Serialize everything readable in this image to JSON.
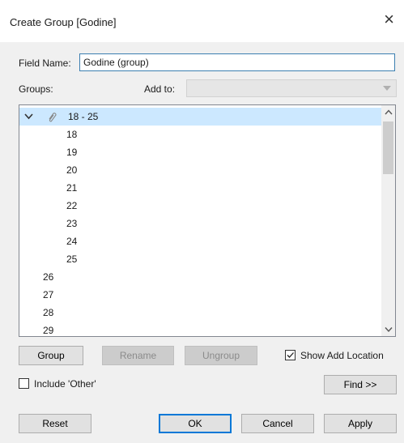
{
  "dialog": {
    "title": "Create Group [Godine]",
    "close_glyph": "×"
  },
  "field_name": {
    "label": "Field Name:",
    "value": "Godine (group)"
  },
  "groups_label": "Groups:",
  "add_to": {
    "label": "Add to:",
    "value": ""
  },
  "tree": {
    "group": {
      "label": "18 - 25",
      "expanded": true,
      "members": [
        "18",
        "19",
        "20",
        "21",
        "22",
        "23",
        "24",
        "25"
      ]
    },
    "ungrouped": [
      "26",
      "27",
      "28",
      "29"
    ]
  },
  "buttons": {
    "group": "Group",
    "rename": "Rename",
    "ungroup": "Ungroup",
    "find": "Find >>",
    "reset": "Reset",
    "ok": "OK",
    "cancel": "Cancel",
    "apply": "Apply"
  },
  "show_add_location": {
    "label": "Show Add Location",
    "checked": true
  },
  "include_other": {
    "label": "Include 'Other'",
    "checked": false
  },
  "icons": {
    "expand": "chevron-down-icon",
    "group": "paperclip-icon",
    "scroll_up": "chevron-up-icon",
    "scroll_down": "chevron-down-icon"
  },
  "colors": {
    "selection": "#cce8ff",
    "focus_border": "#0078d7"
  }
}
